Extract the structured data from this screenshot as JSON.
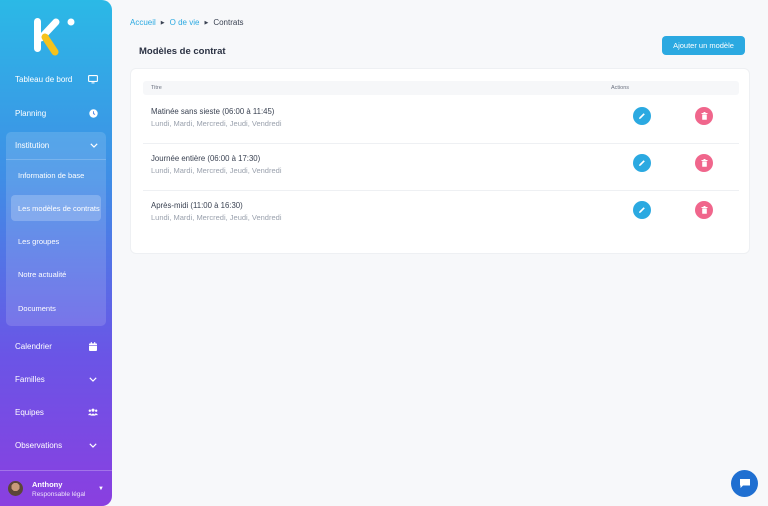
{
  "sidebar": {
    "nav": [
      {
        "label": "Tableau de bord",
        "icon": "monitor-icon"
      },
      {
        "label": "Planning",
        "icon": "clock-icon"
      },
      {
        "label": "Calendrier",
        "icon": "calendar-icon"
      },
      {
        "label": "Familles",
        "icon": "chevron-down-icon"
      },
      {
        "label": "Equipes",
        "icon": "users-icon"
      },
      {
        "label": "Observations",
        "icon": "chevron-down-icon"
      }
    ],
    "institution": {
      "label": "Institution",
      "items": [
        {
          "label": "Information de base"
        },
        {
          "label": "Les modèles de contrats"
        },
        {
          "label": "Les groupes"
        },
        {
          "label": "Notre actualité"
        },
        {
          "label": "Documents"
        }
      ]
    },
    "user": {
      "name": "Anthony",
      "role": "Responsable légal"
    }
  },
  "breadcrumb": {
    "home": "Accueil",
    "section": "O de vie",
    "current": "Contrats"
  },
  "page": {
    "title": "Modèles de contrat",
    "add_label": "Ajouter un modèle"
  },
  "table": {
    "headers": {
      "title": "Titre",
      "actions": "Actions"
    },
    "rows": [
      {
        "title": "Matinée sans sieste (06:00 à 11:45)",
        "days": "Lundi, Mardi, Mercredi, Jeudi, Vendredi"
      },
      {
        "title": "Journée entière (06:00 à 17:30)",
        "days": "Lundi, Mardi, Mercredi, Jeudi, Vendredi"
      },
      {
        "title": "Après-midi (11:00 à 16:30)",
        "days": "Lundi, Mardi, Mercredi, Jeudi, Vendredi"
      }
    ]
  },
  "colors": {
    "accent": "#2ba9e1",
    "danger": "#f0668c",
    "chat": "#1f6fd1"
  }
}
